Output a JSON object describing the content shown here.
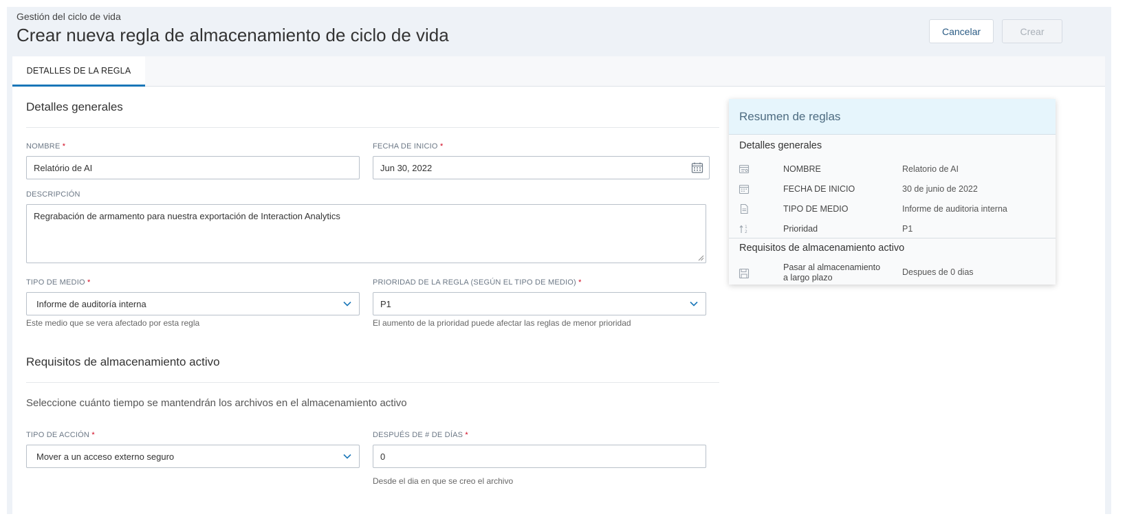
{
  "header": {
    "breadcrumb": "Gestión del ciclo de vida",
    "title": "Crear nueva regla de almacenamiento de ciclo de vida",
    "cancel_label": "Cancelar",
    "create_label": "Crear"
  },
  "tabs": [
    {
      "label": "DETALLES DE LA REGLA",
      "active": true
    }
  ],
  "general": {
    "section_title": "Detalles generales",
    "name": {
      "label": "NOMBRE",
      "required": "*",
      "value": "Relatório de AI"
    },
    "start_date": {
      "label": "FECHA DE INICIO",
      "required": "*",
      "value": "Jun 30, 2022",
      "icon": "calendar-icon"
    },
    "description": {
      "label": "DESCRIPCIÓN",
      "value": "Regrabación de armamento para nuestra exportación de Interaction Analytics"
    },
    "media_type": {
      "label": "TIPO DE MEDIO",
      "required": "*",
      "value": "Informe de auditoría interna",
      "help": "Este medio que se vera afectado por esta regla"
    },
    "priority": {
      "label": "PRIORIDAD DE LA REGLA (SEGÚN EL TIPO DE MEDIO)",
      "required": "*",
      "value": "P1",
      "help": "El aumento de la prioridad puede afectar las reglas de menor prioridad"
    }
  },
  "active_storage": {
    "section_title": "Requisitos de almacenamiento activo",
    "subtitle": "Seleccione cuánto tiempo se mantendrán los archivos en el almacenamiento activo",
    "action_type": {
      "label": "TIPO DE ACCIÓN",
      "required": "*",
      "value": "Mover a un acceso externo seguro"
    },
    "days_after": {
      "label": "DESPUÉS DE # DE DÍAS",
      "required": "*",
      "value": "0",
      "help": "Desde el dia en que se creo el archivo"
    }
  },
  "summary": {
    "title": "Resumen de reglas",
    "general_title": "Detalles generales",
    "rows": [
      {
        "icon": "name-card-icon",
        "label": "NOMBRE",
        "value": "Relatorio de AI"
      },
      {
        "icon": "calendar-icon",
        "label": "FECHA DE INICIO",
        "value": "30 de junio de 2022"
      },
      {
        "icon": "document-icon",
        "label": "TIPO DE MEDIO",
        "value": "Informe de auditoria interna"
      },
      {
        "icon": "priority-sort-icon",
        "label": "Prioridad",
        "value": "P1"
      }
    ],
    "storage_title": "Requisitos de almacenamiento activo",
    "storage_row": {
      "icon": "save-disk-icon",
      "label_line1": "Pasar al almacenamiento",
      "label_line2": "a largo plazo",
      "value": "Despues de 0 dias"
    }
  },
  "colors": {
    "accent": "#1976b8",
    "required": "#d0021b",
    "header_bg": "#eef2f7",
    "summary_head_bg": "#e6f5fc"
  }
}
